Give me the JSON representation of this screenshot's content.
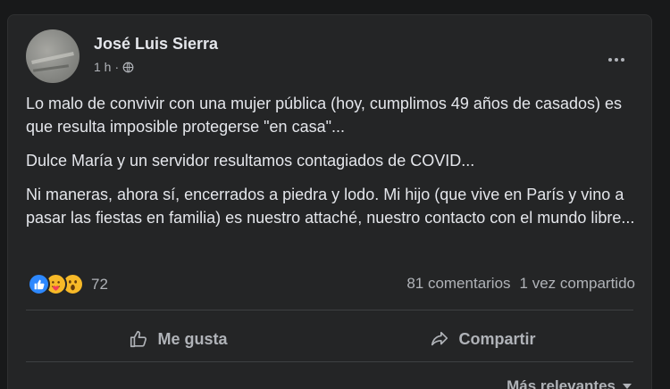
{
  "post": {
    "author": "José Luis Sierra",
    "time": "1 h",
    "separator": "·",
    "paragraphs": [
      "Lo malo de convivir con una mujer pública (hoy, cumplimos 49 años de casados) es que resulta imposible protegerse \"en casa\"...",
      "Dulce María y un servidor resultamos contagiados de COVID...",
      "Ni maneras, ahora sí, encerrados a piedra y lodo. Mi hijo (que vive en París y vino a pasar las fiestas en familia) es nuestro attaché, nuestro contacto con el mundo libre..."
    ]
  },
  "reactions": {
    "icons": [
      "like-icon",
      "care-icon",
      "wow-icon"
    ],
    "count": "72"
  },
  "stats": {
    "comments": "81 comentarios",
    "shares": "1 vez compartido"
  },
  "actions": {
    "like_label": "Me gusta",
    "share_label": "Compartir"
  },
  "sort": {
    "label": "Más relevantes"
  }
}
